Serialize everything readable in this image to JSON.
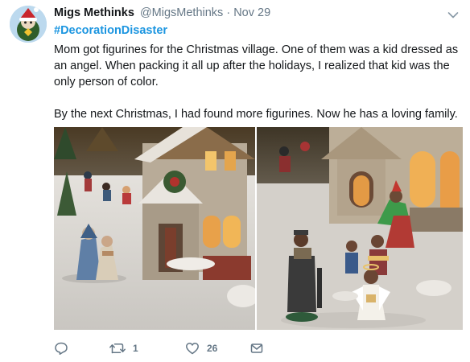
{
  "tweet": {
    "display_name": "Migs Methinks",
    "handle": "@MigsMethinks",
    "separator": "·",
    "timestamp": "Nov 29",
    "hashtag": "#DecorationDisaster",
    "paragraphs": [
      "Mom got figurines for the Christmas village. One of them was a kid dressed as an angel. When packing it all up after the holidays, I realized that kid was the only person of color.",
      "By the next Christmas, I had found more figurines. Now he has a loving family."
    ],
    "media": [
      {
        "name": "photo-village-angel-alone"
      },
      {
        "name": "photo-village-angel-with-family"
      }
    ],
    "actions": {
      "reply": {
        "icon": "reply-icon"
      },
      "retweet": {
        "icon": "retweet-icon",
        "count": "1"
      },
      "like": {
        "icon": "heart-icon",
        "count": "26"
      },
      "dm": {
        "icon": "envelope-icon"
      }
    }
  },
  "colors": {
    "link": "#1b95e0",
    "muted": "#657786",
    "text": "#14171a"
  }
}
